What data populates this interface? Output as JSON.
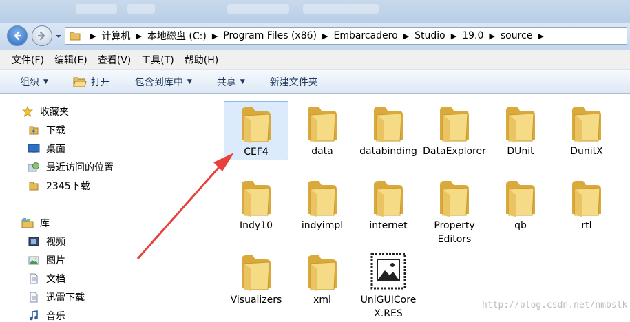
{
  "address": {
    "breadcrumbs": [
      "计算机",
      "本地磁盘 (C:)",
      "Program Files (x86)",
      "Embarcadero",
      "Studio",
      "19.0",
      "source"
    ]
  },
  "menubar": {
    "items": [
      "文件(F)",
      "编辑(E)",
      "查看(V)",
      "工具(T)",
      "帮助(H)"
    ]
  },
  "toolbar": {
    "organize": "组织",
    "open": "打开",
    "include_in_library": "包含到库中",
    "share": "共享",
    "new_folder": "新建文件夹"
  },
  "sidebar": {
    "favorites": {
      "header": "收藏夹",
      "items": [
        "下载",
        "桌面",
        "最近访问的位置",
        "2345下载"
      ]
    },
    "libraries": {
      "header": "库",
      "items": [
        "视频",
        "图片",
        "文档",
        "迅雷下载",
        "音乐"
      ]
    }
  },
  "files": [
    {
      "name": "CEF4",
      "type": "folder",
      "selected": true
    },
    {
      "name": "data",
      "type": "folder"
    },
    {
      "name": "databinding",
      "type": "folder"
    },
    {
      "name": "DataExplorer",
      "type": "folder"
    },
    {
      "name": "DUnit",
      "type": "folder"
    },
    {
      "name": "DunitX",
      "type": "folder"
    },
    {
      "name": "Indy10",
      "type": "folder"
    },
    {
      "name": "indyimpl",
      "type": "folder"
    },
    {
      "name": "internet",
      "type": "folder"
    },
    {
      "name": "Property Editors",
      "type": "folder"
    },
    {
      "name": "qb",
      "type": "folder"
    },
    {
      "name": "rtl",
      "type": "folder"
    },
    {
      "name": "Visualizers",
      "type": "folder"
    },
    {
      "name": "xml",
      "type": "folder"
    },
    {
      "name": "UniGUICoreX.RES",
      "type": "resource-file"
    }
  ],
  "annotation": {
    "color": "#e8403a"
  },
  "watermark": "http://blog.csdn.net/nmbslk"
}
